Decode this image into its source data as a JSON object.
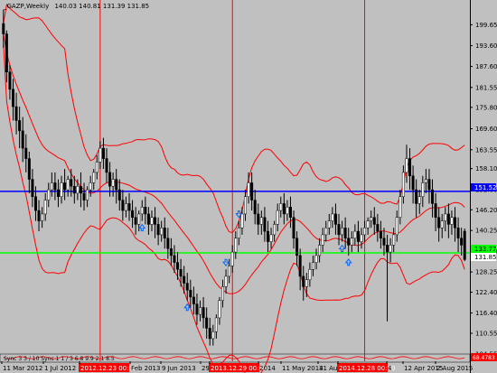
{
  "symbol": {
    "name": "_GAZP,Weekly",
    "ohlc": "140.03 140.81 131.39 131.85"
  },
  "levels": {
    "blue_value": "151.52",
    "green_value": "133.77",
    "last_price": "131.85"
  },
  "indicator_label": "Sync 3  3 / 10  Sync 1  1 / 3  6.8  9.9  2 1  8.5",
  "indicator_value": "68.4783",
  "colors": {
    "background": "#c0c0c0",
    "bull": "#ffffff",
    "bear": "#000000",
    "bands": "#ff0000",
    "separators": "#ff0000",
    "blue_line": "#0000ff",
    "green_line": "#00ff00",
    "arrows": "#0066ff"
  },
  "chart_data": {
    "type": "candlestick",
    "title": "_GAZP,Weekly",
    "ylim": [
      104.55,
      205.75
    ],
    "yticks": [
      199.65,
      193.6,
      187.6,
      181.55,
      175.8,
      169.6,
      163.55,
      158.1,
      152.06,
      146.2,
      140.25,
      134.2,
      128.25,
      122.4,
      116.4,
      110.55,
      104.55
    ],
    "xticks": [
      "11 Mar 2012",
      "1 Jul 2012",
      "2012.12.23 00:00",
      "Feb 2013",
      "9 Jun 2013",
      "29",
      "2013.12.29 00:00",
      "2014",
      "11 May 2014",
      "31 Aug",
      "2014.12.28 00:00",
      "4",
      "12 Apr 2015",
      "2 Aug 2015"
    ],
    "separators": [
      "2012.12.23 00:00",
      "2013.12.29 00:00",
      "2014.12.28 00:00"
    ],
    "horizontal_lines": [
      {
        "value": 151.52,
        "color": "#0000ff"
      },
      {
        "value": 133.77,
        "color": "#00ff00"
      }
    ],
    "candles": [
      {
        "o": 200,
        "h": 204,
        "c": 197,
        "l": 193
      },
      {
        "o": 197,
        "h": 198,
        "c": 186,
        "l": 183
      },
      {
        "o": 186,
        "h": 188,
        "c": 181,
        "l": 178
      },
      {
        "o": 181,
        "h": 184,
        "c": 176,
        "l": 172
      },
      {
        "o": 176,
        "h": 180,
        "c": 172,
        "l": 168
      },
      {
        "o": 172,
        "h": 176,
        "c": 169,
        "l": 164
      },
      {
        "o": 169,
        "h": 173,
        "c": 164,
        "l": 160
      },
      {
        "o": 164,
        "h": 168,
        "c": 161,
        "l": 157
      },
      {
        "o": 161,
        "h": 163,
        "c": 155,
        "l": 151
      },
      {
        "o": 155,
        "h": 158,
        "c": 150,
        "l": 147
      },
      {
        "o": 150,
        "h": 153,
        "c": 146,
        "l": 143
      },
      {
        "o": 146,
        "h": 149,
        "c": 143,
        "l": 140
      },
      {
        "o": 143,
        "h": 147,
        "c": 145,
        "l": 141
      },
      {
        "o": 145,
        "h": 151,
        "c": 149,
        "l": 143
      },
      {
        "o": 149,
        "h": 154,
        "c": 152,
        "l": 147
      },
      {
        "o": 152,
        "h": 157,
        "c": 154,
        "l": 150
      },
      {
        "o": 154,
        "h": 157,
        "c": 152,
        "l": 149
      },
      {
        "o": 152,
        "h": 155,
        "c": 150,
        "l": 147
      },
      {
        "o": 150,
        "h": 156,
        "c": 154,
        "l": 148
      },
      {
        "o": 154,
        "h": 158,
        "c": 152,
        "l": 149
      },
      {
        "o": 152,
        "h": 156,
        "c": 155,
        "l": 150
      },
      {
        "o": 155,
        "h": 158,
        "c": 153,
        "l": 150
      },
      {
        "o": 153,
        "h": 156,
        "c": 151,
        "l": 148
      },
      {
        "o": 151,
        "h": 155,
        "c": 153,
        "l": 149
      },
      {
        "o": 153,
        "h": 157,
        "c": 151,
        "l": 147
      },
      {
        "o": 151,
        "h": 154,
        "c": 149,
        "l": 146
      },
      {
        "o": 149,
        "h": 153,
        "c": 152,
        "l": 147
      },
      {
        "o": 152,
        "h": 156,
        "c": 154,
        "l": 150
      },
      {
        "o": 154,
        "h": 158,
        "c": 157,
        "l": 152
      },
      {
        "o": 157,
        "h": 162,
        "c": 160,
        "l": 155
      },
      {
        "o": 160,
        "h": 166,
        "c": 164,
        "l": 158
      },
      {
        "o": 164,
        "h": 167,
        "c": 161,
        "l": 158
      },
      {
        "o": 161,
        "h": 164,
        "c": 157,
        "l": 154
      },
      {
        "o": 157,
        "h": 160,
        "c": 153,
        "l": 150
      },
      {
        "o": 153,
        "h": 157,
        "c": 155,
        "l": 150
      },
      {
        "o": 155,
        "h": 158,
        "c": 152,
        "l": 148
      },
      {
        "o": 152,
        "h": 155,
        "c": 149,
        "l": 146
      },
      {
        "o": 149,
        "h": 152,
        "c": 146,
        "l": 143
      },
      {
        "o": 146,
        "h": 150,
        "c": 148,
        "l": 144
      },
      {
        "o": 148,
        "h": 151,
        "c": 146,
        "l": 143
      },
      {
        "o": 146,
        "h": 149,
        "c": 144,
        "l": 141
      },
      {
        "o": 144,
        "h": 147,
        "c": 142,
        "l": 139
      },
      {
        "o": 142,
        "h": 146,
        "c": 145,
        "l": 140
      },
      {
        "o": 145,
        "h": 149,
        "c": 147,
        "l": 143
      },
      {
        "o": 147,
        "h": 150,
        "c": 145,
        "l": 142
      },
      {
        "o": 145,
        "h": 147,
        "c": 142,
        "l": 139
      },
      {
        "o": 142,
        "h": 146,
        "c": 144,
        "l": 140
      },
      {
        "o": 144,
        "h": 147,
        "c": 142,
        "l": 138
      },
      {
        "o": 142,
        "h": 144,
        "c": 139,
        "l": 136
      },
      {
        "o": 139,
        "h": 143,
        "c": 141,
        "l": 137
      },
      {
        "o": 141,
        "h": 144,
        "c": 138,
        "l": 135
      },
      {
        "o": 138,
        "h": 141,
        "c": 135,
        "l": 132
      },
      {
        "o": 135,
        "h": 138,
        "c": 133,
        "l": 130
      },
      {
        "o": 133,
        "h": 136,
        "c": 131,
        "l": 128
      },
      {
        "o": 131,
        "h": 134,
        "c": 129,
        "l": 126
      },
      {
        "o": 129,
        "h": 132,
        "c": 127,
        "l": 124
      },
      {
        "o": 127,
        "h": 130,
        "c": 125,
        "l": 122
      },
      {
        "o": 125,
        "h": 128,
        "c": 123,
        "l": 120
      },
      {
        "o": 123,
        "h": 126,
        "c": 121,
        "l": 118
      },
      {
        "o": 121,
        "h": 124,
        "c": 119,
        "l": 116
      },
      {
        "o": 119,
        "h": 122,
        "c": 116,
        "l": 113
      },
      {
        "o": 116,
        "h": 120,
        "c": 118,
        "l": 114
      },
      {
        "o": 118,
        "h": 121,
        "c": 115,
        "l": 112
      },
      {
        "o": 115,
        "h": 118,
        "c": 112,
        "l": 109
      },
      {
        "o": 112,
        "h": 115,
        "c": 109,
        "l": 107
      },
      {
        "o": 109,
        "h": 113,
        "c": 111,
        "l": 107
      },
      {
        "o": 111,
        "h": 116,
        "c": 115,
        "l": 109
      },
      {
        "o": 115,
        "h": 121,
        "c": 120,
        "l": 113
      },
      {
        "o": 120,
        "h": 126,
        "c": 124,
        "l": 118
      },
      {
        "o": 124,
        "h": 129,
        "c": 127,
        "l": 122
      },
      {
        "o": 127,
        "h": 132,
        "c": 130,
        "l": 125
      },
      {
        "o": 130,
        "h": 136,
        "c": 134,
        "l": 128
      },
      {
        "o": 134,
        "h": 140,
        "c": 138,
        "l": 132
      },
      {
        "o": 138,
        "h": 143,
        "c": 141,
        "l": 136
      },
      {
        "o": 141,
        "h": 147,
        "c": 145,
        "l": 139
      },
      {
        "o": 145,
        "h": 152,
        "c": 150,
        "l": 143
      },
      {
        "o": 150,
        "h": 157,
        "c": 154,
        "l": 148
      },
      {
        "o": 154,
        "h": 157,
        "c": 149,
        "l": 146
      },
      {
        "o": 149,
        "h": 152,
        "c": 145,
        "l": 142
      },
      {
        "o": 145,
        "h": 148,
        "c": 142,
        "l": 139
      },
      {
        "o": 142,
        "h": 146,
        "c": 144,
        "l": 139
      },
      {
        "o": 144,
        "h": 147,
        "c": 140,
        "l": 137
      },
      {
        "o": 140,
        "h": 143,
        "c": 137,
        "l": 134
      },
      {
        "o": 137,
        "h": 141,
        "c": 139,
        "l": 135
      },
      {
        "o": 139,
        "h": 143,
        "c": 142,
        "l": 137
      },
      {
        "o": 142,
        "h": 148,
        "c": 146,
        "l": 140
      },
      {
        "o": 146,
        "h": 150,
        "c": 148,
        "l": 144
      },
      {
        "o": 148,
        "h": 151,
        "c": 145,
        "l": 142
      },
      {
        "o": 145,
        "h": 149,
        "c": 147,
        "l": 143
      },
      {
        "o": 147,
        "h": 150,
        "c": 144,
        "l": 141
      },
      {
        "o": 144,
        "h": 146,
        "c": 138,
        "l": 135
      },
      {
        "o": 138,
        "h": 140,
        "c": 133,
        "l": 130
      },
      {
        "o": 133,
        "h": 135,
        "c": 127,
        "l": 123
      },
      {
        "o": 127,
        "h": 130,
        "c": 124,
        "l": 120
      },
      {
        "o": 124,
        "h": 128,
        "c": 126,
        "l": 121
      },
      {
        "o": 126,
        "h": 131,
        "c": 129,
        "l": 124
      },
      {
        "o": 129,
        "h": 133,
        "c": 131,
        "l": 127
      },
      {
        "o": 131,
        "h": 135,
        "c": 133,
        "l": 129
      },
      {
        "o": 133,
        "h": 138,
        "c": 136,
        "l": 131
      },
      {
        "o": 136,
        "h": 141,
        "c": 139,
        "l": 134
      },
      {
        "o": 139,
        "h": 143,
        "c": 141,
        "l": 137
      },
      {
        "o": 141,
        "h": 145,
        "c": 143,
        "l": 139
      },
      {
        "o": 143,
        "h": 147,
        "c": 145,
        "l": 141
      },
      {
        "o": 145,
        "h": 148,
        "c": 142,
        "l": 139
      },
      {
        "o": 142,
        "h": 145,
        "c": 139,
        "l": 136
      },
      {
        "o": 139,
        "h": 143,
        "c": 141,
        "l": 137
      },
      {
        "o": 141,
        "h": 144,
        "c": 138,
        "l": 135
      },
      {
        "o": 138,
        "h": 141,
        "c": 136,
        "l": 133
      },
      {
        "o": 136,
        "h": 140,
        "c": 138,
        "l": 134
      },
      {
        "o": 138,
        "h": 142,
        "c": 140,
        "l": 136
      },
      {
        "o": 140,
        "h": 143,
        "c": 137,
        "l": 134
      },
      {
        "o": 137,
        "h": 141,
        "c": 139,
        "l": 135
      },
      {
        "o": 139,
        "h": 143,
        "c": 141,
        "l": 137
      },
      {
        "o": 141,
        "h": 144,
        "c": 143,
        "l": 139
      },
      {
        "o": 143,
        "h": 146,
        "c": 144,
        "l": 141
      },
      {
        "o": 144,
        "h": 147,
        "c": 142,
        "l": 139
      },
      {
        "o": 142,
        "h": 145,
        "c": 140,
        "l": 137
      },
      {
        "o": 140,
        "h": 143,
        "c": 138,
        "l": 135
      },
      {
        "o": 138,
        "h": 141,
        "c": 136,
        "l": 133
      },
      {
        "o": 136,
        "h": 139,
        "c": 134,
        "l": 114
      },
      {
        "o": 134,
        "h": 138,
        "c": 136,
        "l": 131
      },
      {
        "o": 136,
        "h": 141,
        "c": 139,
        "l": 134
      },
      {
        "o": 139,
        "h": 146,
        "c": 144,
        "l": 137
      },
      {
        "o": 144,
        "h": 152,
        "c": 150,
        "l": 142
      },
      {
        "o": 150,
        "h": 159,
        "c": 157,
        "l": 148
      },
      {
        "o": 157,
        "h": 165,
        "c": 161,
        "l": 154
      },
      {
        "o": 161,
        "h": 164,
        "c": 156,
        "l": 152
      },
      {
        "o": 156,
        "h": 159,
        "c": 152,
        "l": 148
      },
      {
        "o": 152,
        "h": 155,
        "c": 148,
        "l": 144
      },
      {
        "o": 148,
        "h": 152,
        "c": 150,
        "l": 145
      },
      {
        "o": 150,
        "h": 156,
        "c": 154,
        "l": 147
      },
      {
        "o": 154,
        "h": 158,
        "c": 155,
        "l": 151
      },
      {
        "o": 155,
        "h": 158,
        "c": 152,
        "l": 148
      },
      {
        "o": 152,
        "h": 155,
        "c": 148,
        "l": 144
      },
      {
        "o": 148,
        "h": 151,
        "c": 144,
        "l": 140
      },
      {
        "o": 144,
        "h": 147,
        "c": 141,
        "l": 137
      },
      {
        "o": 141,
        "h": 145,
        "c": 143,
        "l": 138
      },
      {
        "o": 143,
        "h": 147,
        "c": 145,
        "l": 140
      },
      {
        "o": 145,
        "h": 148,
        "c": 142,
        "l": 138
      },
      {
        "o": 142,
        "h": 146,
        "c": 144,
        "l": 139
      },
      {
        "o": 144,
        "h": 147,
        "c": 141,
        "l": 137
      },
      {
        "o": 141,
        "h": 144,
        "c": 138,
        "l": 134
      },
      {
        "o": 138,
        "h": 141,
        "c": 136,
        "l": 133
      },
      {
        "o": 140.03,
        "h": 140.81,
        "c": 131.85,
        "l": 131.39
      }
    ]
  }
}
